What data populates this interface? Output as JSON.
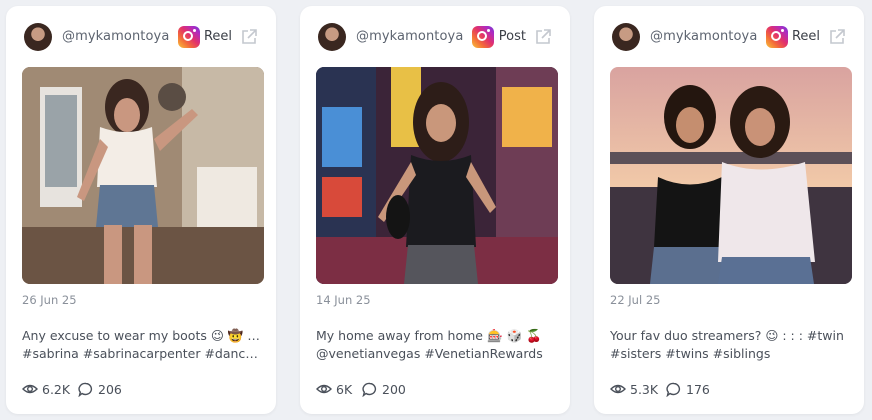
{
  "posts": [
    {
      "handle": "@mykamontoya",
      "type": "Reel",
      "date": "26 Jun 25",
      "caption_line1": "Any excuse to wear my boots 😉 🤠 : : :",
      "caption_line2": "#sabrina #sabrinacarpenter #dance…",
      "views": "6.2K",
      "comments": "206"
    },
    {
      "handle": "@mykamontoya",
      "type": "Post",
      "date": "14 Jun 25",
      "caption_line1": "My home away from home 🎰 🎲 🍒",
      "caption_line2": "@venetianvegas #VenetianRewards",
      "views": "6K",
      "comments": "200"
    },
    {
      "handle": "@mykamontoya",
      "type": "Reel",
      "date": "22 Jul 25",
      "caption_line1": "Your fav duo streamers? 😉 : : : #twin",
      "caption_line2": "#sisters #twins #siblings",
      "views": "5.3K",
      "comments": "176"
    }
  ],
  "icons": {
    "platform": "instagram-icon",
    "external": "external-link-icon",
    "views": "eye-icon",
    "comments": "comment-icon"
  },
  "colors": {
    "background": "#eef0f4",
    "card": "#ffffff",
    "text": "#4a505a",
    "muted": "#8a909a"
  }
}
